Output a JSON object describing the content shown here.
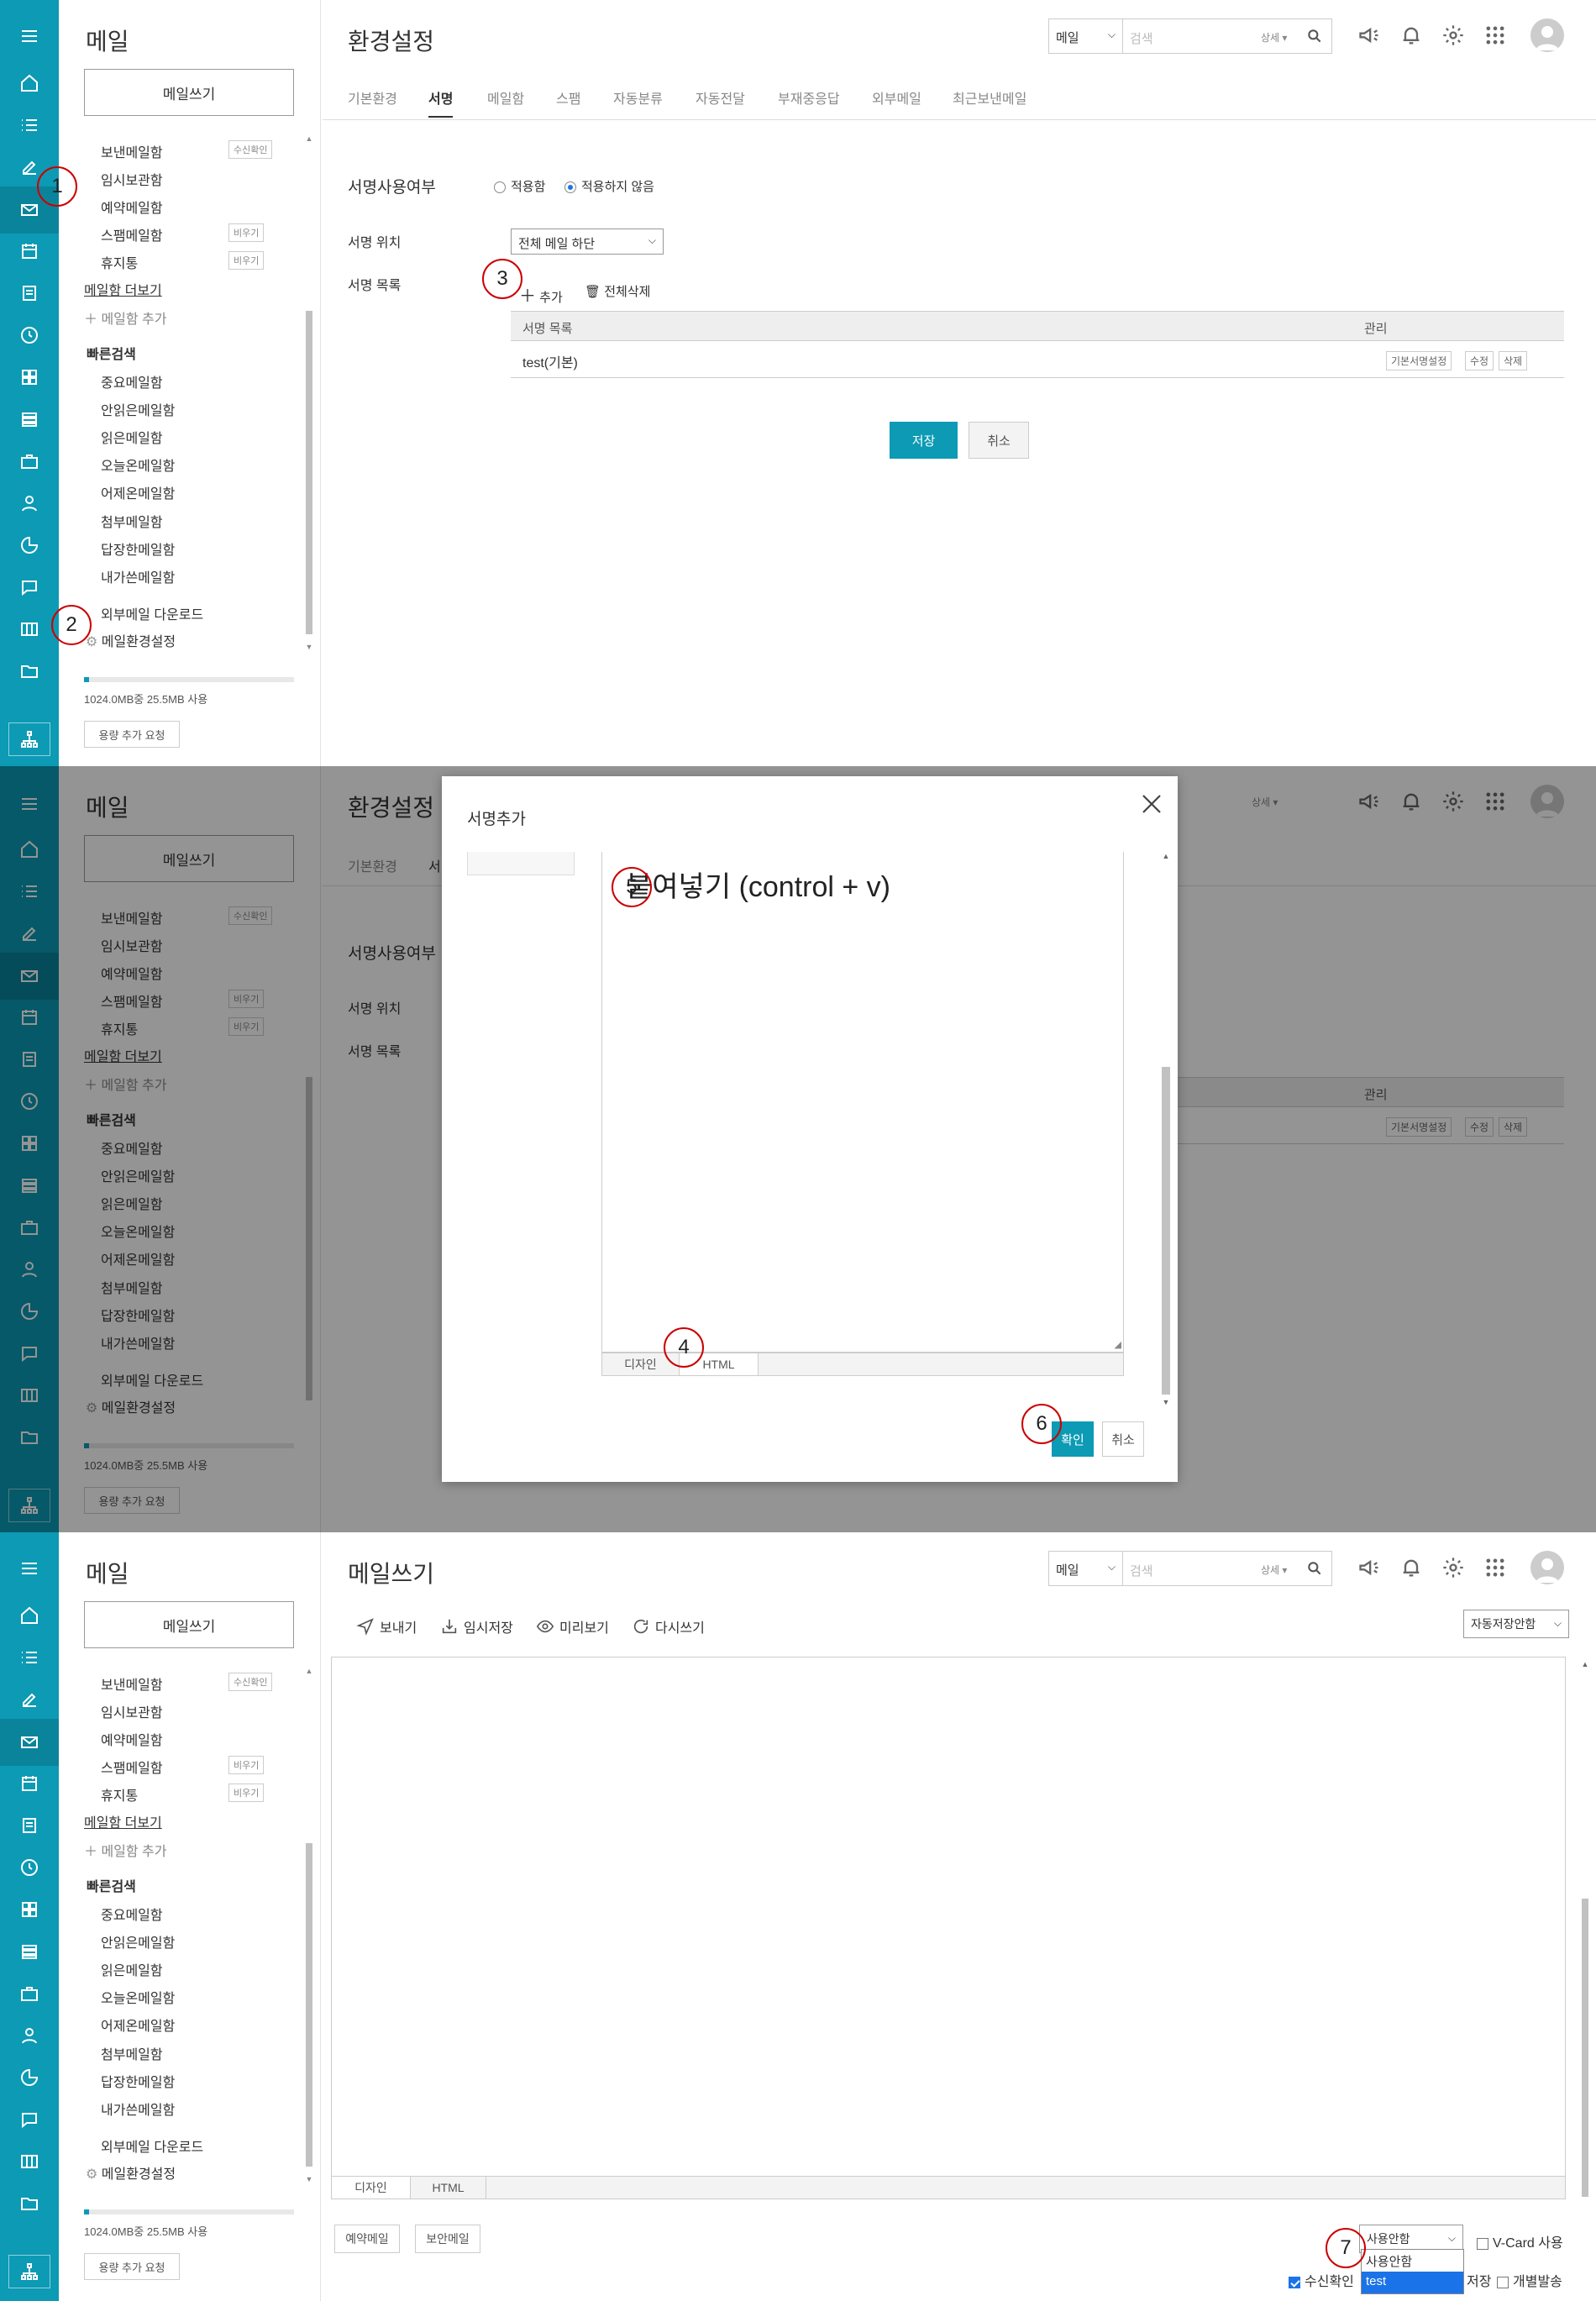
{
  "panel1": {
    "sidebar": {
      "title": "메일",
      "write_button": "메일쓰기",
      "folders": [
        {
          "label": "보낸메일함",
          "tag": "수신확인"
        },
        {
          "label": "임시보관함",
          "tag": ""
        },
        {
          "label": "예약메일함",
          "tag": ""
        },
        {
          "label": "스팸메일함",
          "tag": "비우기"
        },
        {
          "label": "휴지통",
          "tag": "비우기"
        }
      ],
      "more_folders": "메일함 더보기",
      "add_folder": "메일함 추가",
      "quick_search_title": "빠른검색",
      "quick_items": [
        "중요메일함",
        "안읽은메일함",
        "읽은메일함",
        "오늘온메일함",
        "어제온메일함",
        "첨부메일함",
        "답장한메일함",
        "내가쓴메일함"
      ],
      "external_download": "외부메일 다운로드",
      "mail_settings": "메일환경설정",
      "quota_text": "1024.0MB중 25.5MB 사용",
      "quota_button": "용량 추가 요청",
      "quota_fraction": 0.025
    },
    "header": {
      "title": "환경설정",
      "search_select": "메일",
      "search_placeholder": "검색",
      "search_detail": "상세 ▾"
    },
    "tabs": [
      "기본환경",
      "서명",
      "메일함",
      "스팸",
      "자동분류",
      "자동전달",
      "부재중응답",
      "외부메일",
      "최근보낸메일"
    ],
    "active_tab": "서명",
    "signature": {
      "use_label": "서명사용여부",
      "radio_use": "적용함",
      "radio_notuse": "적용하지 않음",
      "position_label": "서명 위치",
      "position_value": "전체 메일 하단",
      "list_label": "서명 목록",
      "add": "추가",
      "delete_all": "전체삭제",
      "col_name": "서명 목록",
      "col_manage": "관리",
      "rows": [
        {
          "name": "test(기본)",
          "actions": [
            "기본서명설정",
            "수정",
            "삭제"
          ]
        }
      ],
      "save": "저장",
      "cancel": "취소"
    },
    "markers": [
      "1",
      "2",
      "3"
    ]
  },
  "panel2": {
    "header_title": "환경설정",
    "tab_visible": "기본환경",
    "tab_partial": "서",
    "label_use": "서명사용여부",
    "label_pos": "서명 위치",
    "label_list": "서명 목록",
    "col_manage": "관리",
    "detail": "상세 ▾",
    "row_actions": [
      "기본서명설정",
      "수정",
      "삭제"
    ],
    "modal": {
      "title": "서명추가",
      "paste_hint": "붙여넣기 (control + v)",
      "tab_design": "디자인",
      "tab_html": "HTML",
      "confirm": "확인",
      "cancel": "취소"
    },
    "markers": [
      "4",
      "5",
      "6"
    ]
  },
  "panel3": {
    "header_title": "메일쓰기",
    "search_select": "메일",
    "search_placeholder": "검색",
    "search_detail": "상세 ▾",
    "toolbar": {
      "send": "보내기",
      "draft": "임시저장",
      "preview": "미리보기",
      "rewrite": "다시쓰기",
      "autosave": "자동저장안함"
    },
    "editor_tabs": {
      "design": "디자인",
      "html": "HTML"
    },
    "bottom": {
      "reserve": "예약메일",
      "secure": "보안메일",
      "sig_select": "사용안함",
      "sig_options": [
        "사용안함",
        "test"
      ],
      "vcard": "V-Card 사용",
      "receipt": "수신확인",
      "save_partial": "저장",
      "individual": "개별발송"
    },
    "marker": "7"
  },
  "colors": {
    "accent": "#0c9ab4",
    "rail": "#0c9ab4",
    "marker": "#cc0000"
  }
}
